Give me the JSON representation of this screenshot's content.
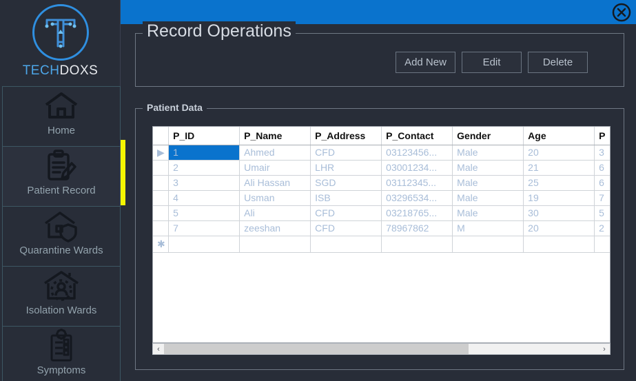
{
  "brand": {
    "name_part1": "TECH",
    "name_part2": "DOXS",
    "logo_icon": "circuit-t-logo"
  },
  "sidebar": {
    "items": [
      {
        "label": "Home",
        "icon": "home-icon",
        "active": false
      },
      {
        "label": "Patient Record",
        "icon": "clipboard-pencil-icon",
        "active": true
      },
      {
        "label": "Quarantine Wards",
        "icon": "house-shield-icon",
        "active": false
      },
      {
        "label": "Isolation Wards",
        "icon": "house-person-icon",
        "active": false
      },
      {
        "label": "Symptoms",
        "icon": "checklist-virus-icon",
        "active": false
      }
    ],
    "accent_color": "#f5f500"
  },
  "titlebar": {
    "color": "#0a73cd",
    "close_icon": "close-circle-icon"
  },
  "record_operations": {
    "title": "Record Operations",
    "buttons": [
      {
        "label": "Add New",
        "name": "add-new-button"
      },
      {
        "label": "Edit",
        "name": "edit-button"
      },
      {
        "label": "Delete",
        "name": "delete-button"
      }
    ]
  },
  "patient_data": {
    "title": "Patient Data",
    "columns": [
      "P_ID",
      "P_Name",
      "P_Address",
      "P_Contact",
      "Gender",
      "Age",
      "P"
    ],
    "rows": [
      {
        "marker": "▶",
        "selected_col": 0,
        "cells": [
          "1",
          "Ahmed",
          "CFD",
          "03123456...",
          "Male",
          "20",
          "3"
        ]
      },
      {
        "marker": "",
        "selected_col": -1,
        "cells": [
          "2",
          "Umair",
          "LHR",
          "03001234...",
          "Male",
          "21",
          "6"
        ]
      },
      {
        "marker": "",
        "selected_col": -1,
        "cells": [
          "3",
          "Ali Hassan",
          "SGD",
          "03112345...",
          "Male",
          "25",
          "6"
        ]
      },
      {
        "marker": "",
        "selected_col": -1,
        "cells": [
          "4",
          "Usman",
          "ISB",
          "03296534...",
          "Male",
          "19",
          "7"
        ]
      },
      {
        "marker": "",
        "selected_col": -1,
        "cells": [
          "5",
          "Ali",
          "CFD",
          "03218765...",
          "Male",
          "30",
          "5"
        ]
      },
      {
        "marker": "",
        "selected_col": -1,
        "cells": [
          "7",
          "zeeshan",
          "CFD",
          "78967862",
          "M",
          "20",
          "2"
        ]
      }
    ],
    "new_row_marker": "✱",
    "selection_color": "#0a73cd",
    "cell_text_color": "#a8bdd8"
  },
  "scrollbar": {
    "left_arrow": "‹",
    "right_arrow": "›",
    "thumb_percent": "70"
  }
}
